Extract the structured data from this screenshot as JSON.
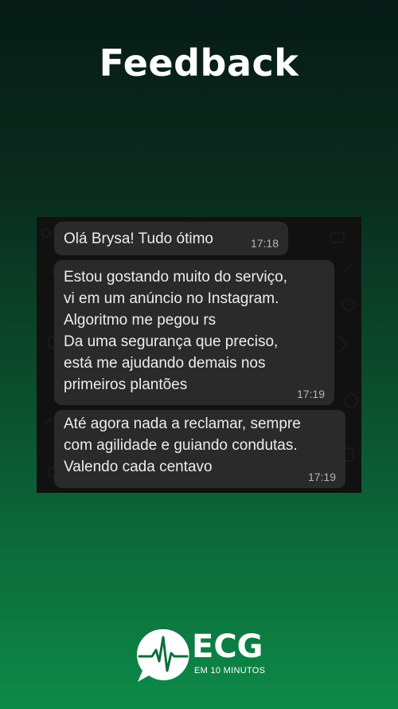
{
  "header": {
    "title": "Feedback"
  },
  "chat": {
    "messages": [
      {
        "text": "Olá Brysa! Tudo ótimo",
        "time": "17:18"
      },
      {
        "text": "Estou gostando muito do serviço,\nvi em um anúncio no Instagram.\nAlgoritmo me pegou rs\nDa uma segurança que preciso,\nestá me ajudando demais nos\nprimeiros plantões",
        "time": "17:19"
      },
      {
        "text": "Até agora nada a reclamar, sempre\ncom agilidade e guiando condutas.\nValendo cada centavo",
        "time": "17:19"
      }
    ]
  },
  "brand": {
    "name": "ECG",
    "tagline": "EM 10 MINUTOS",
    "logo_icon": "heartbeat-speech-bubble-icon"
  },
  "colors": {
    "background_top": "#061b15",
    "background_bottom": "#0d8a48",
    "bubble": "#2a2a2a",
    "chat_background": "#111111"
  }
}
